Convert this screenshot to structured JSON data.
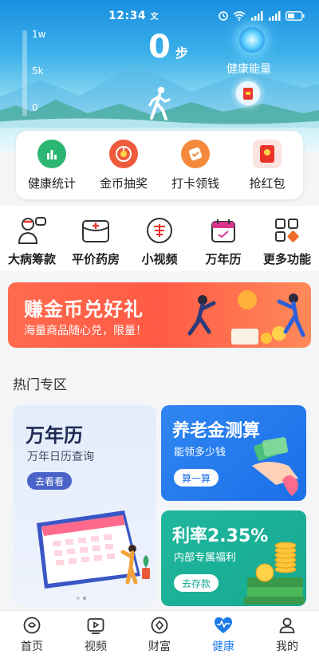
{
  "status_bar": {
    "time": "12:34",
    "time_suffix": "文"
  },
  "hero": {
    "scale_labels": [
      "1w",
      "5k",
      "0"
    ],
    "steps_value": "0",
    "steps_unit": "步",
    "energy_label": "健康能量"
  },
  "quick_actions": [
    {
      "label": "健康统计",
      "icon": "bar-chart-icon",
      "color": "#2bb673"
    },
    {
      "label": "金币抽奖",
      "icon": "lottery-wheel-icon",
      "color": "#ef5a3c"
    },
    {
      "label": "打卡领钱",
      "icon": "check-in-icon",
      "color": "#f58a3c"
    },
    {
      "label": "抢红包",
      "icon": "red-packet-icon",
      "color": "#e8332a"
    }
  ],
  "services": [
    {
      "label": "大病筹款",
      "icon": "doctor-icon"
    },
    {
      "label": "平价药房",
      "icon": "pharmacy-icon"
    },
    {
      "label": "小视频",
      "icon": "short-video-icon"
    },
    {
      "label": "万年历",
      "icon": "calendar-icon"
    },
    {
      "label": "更多功能",
      "icon": "more-grid-icon"
    }
  ],
  "banner": {
    "title": "赚金币兑好礼",
    "subtitle": "海量商品随心兑，限量！"
  },
  "hot_section": {
    "title": "热门专区",
    "calendar_card": {
      "title": "万年历",
      "subtitle": "万年日历查询",
      "button": "去看看"
    },
    "pension_card": {
      "title": "养老金测算",
      "subtitle": "能领多少钱",
      "button": "算一算"
    },
    "rate_card": {
      "title": "利率2.35%",
      "subtitle": "内部专属福利",
      "button": "去存款"
    }
  },
  "tabbar": [
    {
      "label": "首页",
      "icon": "home-icon",
      "active": false
    },
    {
      "label": "视频",
      "icon": "video-icon",
      "active": false
    },
    {
      "label": "财富",
      "icon": "wealth-icon",
      "active": false
    },
    {
      "label": "健康",
      "icon": "heart-pulse-icon",
      "active": true
    },
    {
      "label": "我的",
      "icon": "profile-icon",
      "active": false
    }
  ],
  "colors": {
    "accent": "#1e7ae6",
    "banner": "#ff5a45",
    "hero_top": "#1a8fe0"
  }
}
